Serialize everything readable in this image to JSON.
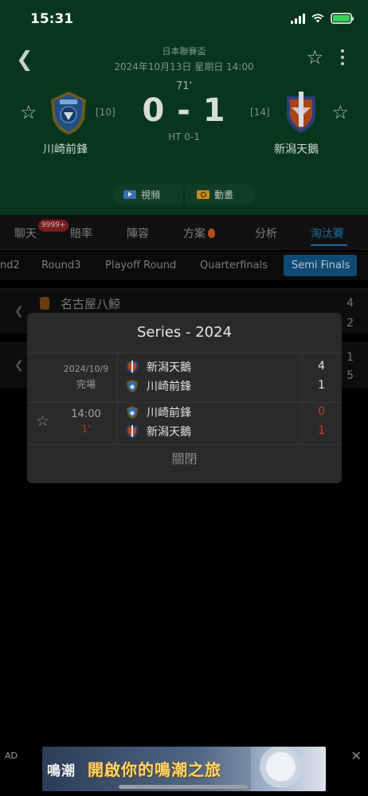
{
  "status_bar": {
    "time": "15:31"
  },
  "match": {
    "league": "日本聯賽盃",
    "datetime": "2024年10月13日 星期日 14:00",
    "minute": "71'",
    "score": "0 - 1",
    "halftime": "HT 0-1",
    "home": {
      "name": "川崎前鋒",
      "rank": "[10]"
    },
    "away": {
      "name": "新潟天鵝",
      "rank": "[14]"
    },
    "buttons": {
      "video": "視頻",
      "animation": "動畫"
    }
  },
  "tabs": [
    {
      "label": "聊天",
      "badge": "9999+"
    },
    {
      "label": "賠率"
    },
    {
      "label": "陣容"
    },
    {
      "label": "方案"
    },
    {
      "label": "分析"
    },
    {
      "label": "淘汰賽",
      "active": true
    }
  ],
  "rounds": [
    {
      "label": "nd2"
    },
    {
      "label": "Round3"
    },
    {
      "label": "Playoff Round"
    },
    {
      "label": "Quarterfinals"
    },
    {
      "label": "Semi Finals",
      "active": true
    }
  ],
  "bracket": [
    {
      "team": "名古屋八鯨",
      "values": [
        "4",
        "2"
      ]
    },
    {
      "team": "",
      "values": [
        "1",
        "5"
      ]
    }
  ],
  "series_modal": {
    "title": "Series - 2024",
    "matches": [
      {
        "date": "2024/10/9",
        "status": "完場",
        "team1": "新潟天鵝",
        "score1": "4",
        "team2": "川崎前鋒",
        "score2": "1"
      },
      {
        "date": "14:00",
        "status": "1'",
        "team1": "川崎前鋒",
        "score1": "0",
        "team2": "新潟天鵝",
        "score2": "1"
      }
    ],
    "close_label": "關閉"
  },
  "ad": {
    "label": "AD",
    "brand": "鳴潮",
    "text": "開啟你的鳴潮之旅"
  },
  "colors": {
    "header_bg": "#08351e",
    "accent_blue": "#1d6a9e",
    "live_red": "#cf3a32",
    "modal_bg": "#2a2a2a"
  }
}
